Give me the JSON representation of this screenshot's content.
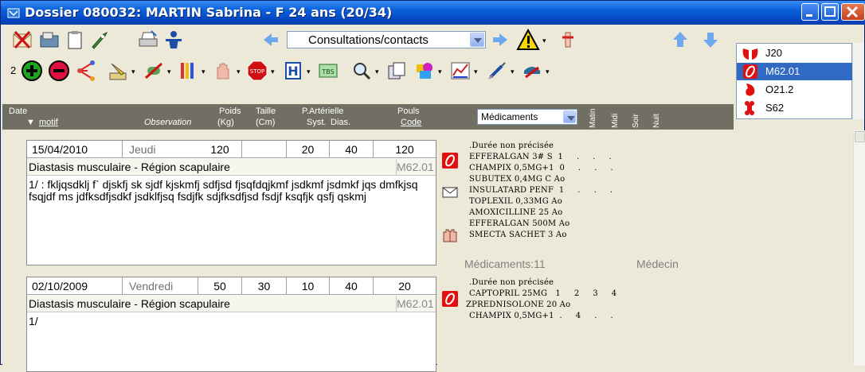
{
  "window": {
    "title": "Dossier 080032: MARTIN Sabrina - F 24 ans (20/34)"
  },
  "toolbar": {
    "combo_value": "Consultations/contacts",
    "counter": "2"
  },
  "diagnoses": [
    {
      "code": "J20",
      "selected": false
    },
    {
      "code": "M62.01",
      "selected": true
    },
    {
      "code": "O21.2",
      "selected": false
    },
    {
      "code": "S62",
      "selected": false
    }
  ],
  "columns": {
    "date": "Date",
    "motif": "motif",
    "observation": "Observation",
    "poids": "Poids",
    "poids_unit": "(Kg)",
    "taille": "Taille",
    "taille_unit": "(Cm)",
    "pa": "P.Artérielle",
    "pa_syst": "Syst.",
    "pa_dias": "Dias.",
    "pouls": "Pouls",
    "code": "Code",
    "meds_select": "Médicaments",
    "matin": "Matin",
    "midi": "Midi",
    "soir": "Soir",
    "nuit": "Nuit"
  },
  "consultations": [
    {
      "date": "15/04/2010",
      "day": "Jeudi",
      "poids": "120",
      "taille": "",
      "syst": "20",
      "dias": "40",
      "pouls": "120",
      "motif": "Diastasis musculaire - Région scapulaire",
      "code": "M62.01",
      "observation": "1/ :  fkljqsdklj f` djskfj sk sjdf kjskmfj sdfjsd fjsqfdqjkmf jsdkmf jsdmkf jqs dmfkjsq fsqjdf ms jdfksdfjsdkf jsdklfjsq fsdjfk sdjfksdfjsd fsdjf ksqfjk qsfj qskmj",
      "prescription": {
        "duration": ".Durée non précisée",
        "lines": [
          "EFFERALGAN 3# S  1     .     .     .",
          "CHAMPIX 0,5MG+1  0     .     .     .",
          "SUBUTEX 0,4MG C Ao",
          "INSULATARD PENF  1     .     .     .",
          "TOPLEXIL 0,33MG Ao",
          "AMOXICILLINE 25 Ao",
          "EFFERALGAN 500M Ao",
          "SMECTA SACHET 3 Ao"
        ],
        "summary_left": "Médicaments:11",
        "summary_right": "Médecin"
      }
    },
    {
      "date": "02/10/2009",
      "day": "Vendredi",
      "poids": "50",
      "taille": "30",
      "syst": "10",
      "dias": "40",
      "pouls": "20",
      "motif": "Diastasis musculaire - Région scapulaire",
      "code": "M62.01",
      "observation": "1/",
      "prescription": {
        "duration": ".Durée non précisée",
        "lines": [
          "CAPTOPRIL 25MG   1     2     3     4",
          "ZPREDNISOLONE 20 Ao",
          "CHAMPIX 0,5MG+1  .     4     .     ."
        ]
      }
    }
  ],
  "colors": {
    "titlebar": "#0a5fd8",
    "header": "#716f64",
    "selection": "#316ac5",
    "background": "#ece9d8"
  }
}
